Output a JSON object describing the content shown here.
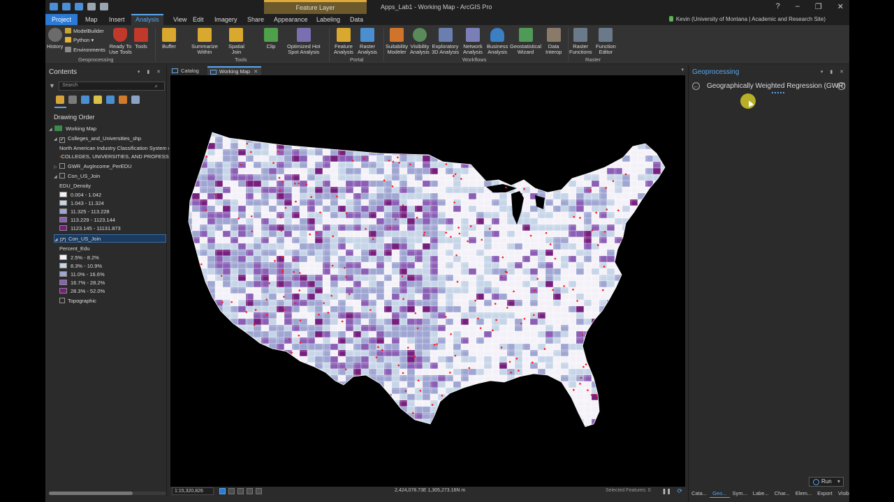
{
  "app": {
    "title": "Apps_Lab1 - Working Map - ArcGIS Pro",
    "contextual_tab": "Feature Layer",
    "user": "Kevin (University of Montana | Academic and Research Site)",
    "window_controls": {
      "help": "?",
      "minimize": "–",
      "restore": "❐",
      "close": "✕"
    }
  },
  "tabs": [
    "Project",
    "Map",
    "Insert",
    "Analysis",
    "View",
    "Edit",
    "Imagery",
    "Share",
    "Appearance",
    "Labeling",
    "Data"
  ],
  "active_tab": "Analysis",
  "ribbon": {
    "geoprocessing": {
      "label": "Geoprocessing",
      "history": "History",
      "modelbuilder": "ModelBuilder",
      "python": "Python",
      "environments": "Environments",
      "ready_to_use_1": "Ready To",
      "ready_to_use_2": "Use Tools",
      "tools": "Tools"
    },
    "tools_group": {
      "label": "Tools",
      "buffer": "Buffer",
      "summarize_1": "Summarize",
      "summarize_2": "Within",
      "spatial_1": "Spatial",
      "spatial_2": "Join",
      "clip": "Clip",
      "hotspot_1": "Optimized Hot",
      "hotspot_2": "Spot Analysis"
    },
    "portal": {
      "label": "Portal",
      "feature_1": "Feature",
      "feature_2": "Analysis",
      "raster_1": "Raster",
      "raster_2": "Analysis"
    },
    "workflows": {
      "label": "Workflows",
      "suit_1": "Suitability",
      "suit_2": "Modeler",
      "vis_1": "Visibility",
      "vis_2": "Analysis",
      "expl_1": "Exploratory",
      "expl_2": "3D Analysis",
      "net_1": "Network",
      "net_2": "Analysis",
      "bus_1": "Business",
      "bus_2": "Analysis",
      "geostat_1": "Geostatistical",
      "geostat_2": "Wizard",
      "interop_1": "Data",
      "interop_2": "Interop"
    },
    "raster_group": {
      "label": "Raster",
      "rf_1": "Raster",
      "rf_2": "Functions",
      "fe_1": "Function",
      "fe_2": "Editor"
    }
  },
  "contents": {
    "title": "Contents",
    "search_placeholder": "Search",
    "drawing_order": "Drawing Order",
    "working_map": "Working Map",
    "colleges_layer": "Colleges_and_Universities_shp",
    "naics_header": "North American Industry Classification System (N",
    "naics_value": "COLLEGES, UNIVERSITIES, AND PROFESSIONAL",
    "gwr_layer": "GWR_AvgIncome_PerEDU",
    "con_join_1": "Con_US_Join",
    "edu_density": "EDU_Density",
    "density_classes": [
      "0.004 - 1.042",
      "1.043 - 11.324",
      "11.325 - 113.228",
      "113.229 - 1123.144",
      "1123.145 - 11131.873"
    ],
    "con_join_2": "Con_US_Join",
    "percent_edu": "Percent_Edu",
    "percent_classes": [
      "2.5% - 8.2%",
      "8.3% - 10.9%",
      "11.0% - 16.6%",
      "16.7% - 28.2%",
      "28.3% - 52.0%"
    ],
    "topographic": "Topographic"
  },
  "class_colors": [
    "#f4f2f8",
    "#c7d5e8",
    "#9fa6d2",
    "#8c5fb6",
    "#771f7e"
  ],
  "map_view": {
    "catalog_tab": "Catalog",
    "working_map_tab": "Working Map",
    "scale": "1:15,320,826",
    "coordinates": "2,424,078.73E 1,305,273.16N m",
    "selected_features": "Selected Features: 0"
  },
  "geoprocessing": {
    "title": "Geoprocessing",
    "tool_name": "Geographically Weighted Regression (GWR)",
    "run": "Run",
    "bottom_tabs": [
      "Cata...",
      "Geo...",
      "Sym...",
      "Labe...",
      "Char...",
      "Elem...",
      "Export",
      "Visib..."
    ]
  }
}
